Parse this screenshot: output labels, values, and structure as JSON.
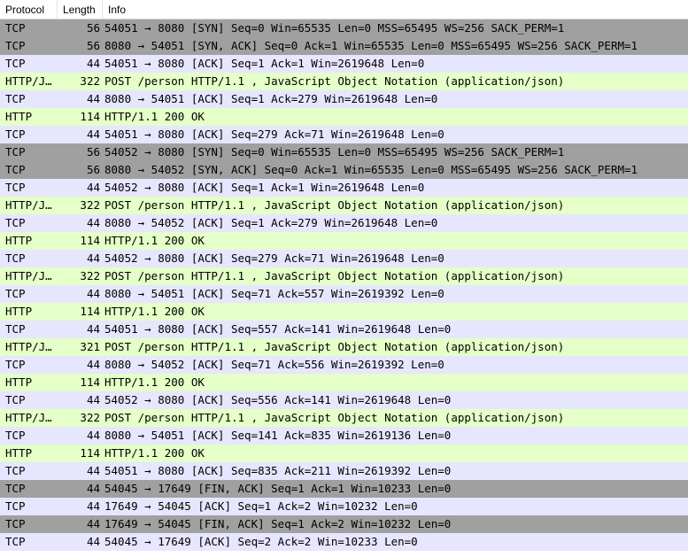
{
  "colors": {
    "tcp": "#e7e6ff",
    "http": "#e4ffc7",
    "syn_fin": "#a0a0a0"
  },
  "columns": {
    "protocol": "Protocol",
    "length": "Length",
    "info": "Info"
  },
  "packets": [
    {
      "protocol": "TCP",
      "length": "56",
      "info": "54051 → 8080 [SYN] Seq=0 Win=65535 Len=0 MSS=65495 WS=256 SACK_PERM=1",
      "kind": "syn_fin"
    },
    {
      "protocol": "TCP",
      "length": "56",
      "info": "8080 → 54051 [SYN, ACK] Seq=0 Ack=1 Win=65535 Len=0 MSS=65495 WS=256 SACK_PERM=1",
      "kind": "syn_fin"
    },
    {
      "protocol": "TCP",
      "length": "44",
      "info": "54051 → 8080 [ACK] Seq=1 Ack=1 Win=2619648 Len=0",
      "kind": "tcp"
    },
    {
      "protocol": "HTTP/J…",
      "length": "322",
      "info": "POST /person HTTP/1.1 , JavaScript Object Notation (application/json)",
      "kind": "http"
    },
    {
      "protocol": "TCP",
      "length": "44",
      "info": "8080 → 54051 [ACK] Seq=1 Ack=279 Win=2619648 Len=0",
      "kind": "tcp"
    },
    {
      "protocol": "HTTP",
      "length": "114",
      "info": "HTTP/1.1 200 OK",
      "kind": "http"
    },
    {
      "protocol": "TCP",
      "length": "44",
      "info": "54051 → 8080 [ACK] Seq=279 Ack=71 Win=2619648 Len=0",
      "kind": "tcp"
    },
    {
      "protocol": "TCP",
      "length": "56",
      "info": "54052 → 8080 [SYN] Seq=0 Win=65535 Len=0 MSS=65495 WS=256 SACK_PERM=1",
      "kind": "syn_fin"
    },
    {
      "protocol": "TCP",
      "length": "56",
      "info": "8080 → 54052 [SYN, ACK] Seq=0 Ack=1 Win=65535 Len=0 MSS=65495 WS=256 SACK_PERM=1",
      "kind": "syn_fin"
    },
    {
      "protocol": "TCP",
      "length": "44",
      "info": "54052 → 8080 [ACK] Seq=1 Ack=1 Win=2619648 Len=0",
      "kind": "tcp"
    },
    {
      "protocol": "HTTP/J…",
      "length": "322",
      "info": "POST /person HTTP/1.1 , JavaScript Object Notation (application/json)",
      "kind": "http"
    },
    {
      "protocol": "TCP",
      "length": "44",
      "info": "8080 → 54052 [ACK] Seq=1 Ack=279 Win=2619648 Len=0",
      "kind": "tcp"
    },
    {
      "protocol": "HTTP",
      "length": "114",
      "info": "HTTP/1.1 200 OK",
      "kind": "http"
    },
    {
      "protocol": "TCP",
      "length": "44",
      "info": "54052 → 8080 [ACK] Seq=279 Ack=71 Win=2619648 Len=0",
      "kind": "tcp"
    },
    {
      "protocol": "HTTP/J…",
      "length": "322",
      "info": "POST /person HTTP/1.1 , JavaScript Object Notation (application/json)",
      "kind": "http"
    },
    {
      "protocol": "TCP",
      "length": "44",
      "info": "8080 → 54051 [ACK] Seq=71 Ack=557 Win=2619392 Len=0",
      "kind": "tcp"
    },
    {
      "protocol": "HTTP",
      "length": "114",
      "info": "HTTP/1.1 200 OK",
      "kind": "http"
    },
    {
      "protocol": "TCP",
      "length": "44",
      "info": "54051 → 8080 [ACK] Seq=557 Ack=141 Win=2619648 Len=0",
      "kind": "tcp"
    },
    {
      "protocol": "HTTP/J…",
      "length": "321",
      "info": "POST /person HTTP/1.1 , JavaScript Object Notation (application/json)",
      "kind": "http"
    },
    {
      "protocol": "TCP",
      "length": "44",
      "info": "8080 → 54052 [ACK] Seq=71 Ack=556 Win=2619392 Len=0",
      "kind": "tcp"
    },
    {
      "protocol": "HTTP",
      "length": "114",
      "info": "HTTP/1.1 200 OK",
      "kind": "http"
    },
    {
      "protocol": "TCP",
      "length": "44",
      "info": "54052 → 8080 [ACK] Seq=556 Ack=141 Win=2619648 Len=0",
      "kind": "tcp"
    },
    {
      "protocol": "HTTP/J…",
      "length": "322",
      "info": "POST /person HTTP/1.1 , JavaScript Object Notation (application/json)",
      "kind": "http"
    },
    {
      "protocol": "TCP",
      "length": "44",
      "info": "8080 → 54051 [ACK] Seq=141 Ack=835 Win=2619136 Len=0",
      "kind": "tcp"
    },
    {
      "protocol": "HTTP",
      "length": "114",
      "info": "HTTP/1.1 200 OK",
      "kind": "http"
    },
    {
      "protocol": "TCP",
      "length": "44",
      "info": "54051 → 8080 [ACK] Seq=835 Ack=211 Win=2619392 Len=0",
      "kind": "tcp"
    },
    {
      "protocol": "TCP",
      "length": "44",
      "info": "54045 → 17649 [FIN, ACK] Seq=1 Ack=1 Win=10233 Len=0",
      "kind": "syn_fin"
    },
    {
      "protocol": "TCP",
      "length": "44",
      "info": "17649 → 54045 [ACK] Seq=1 Ack=2 Win=10232 Len=0",
      "kind": "tcp"
    },
    {
      "protocol": "TCP",
      "length": "44",
      "info": "17649 → 54045 [FIN, ACK] Seq=1 Ack=2 Win=10232 Len=0",
      "kind": "syn_fin"
    },
    {
      "protocol": "TCP",
      "length": "44",
      "info": "54045 → 17649 [ACK] Seq=2 Ack=2 Win=10233 Len=0",
      "kind": "tcp"
    }
  ]
}
